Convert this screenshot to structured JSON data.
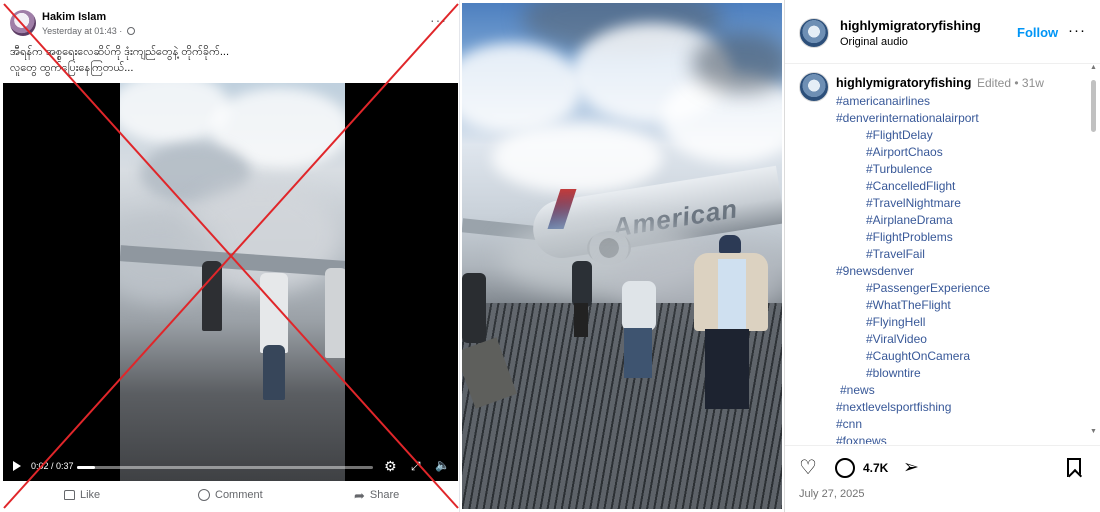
{
  "facebook_post": {
    "author": "Hakim Islam",
    "timestamp": "Yesterday at 01:43 · ",
    "more_label": "···",
    "caption_lines": [
      "အီရန်က အစ္စရေးလေဆိပ်ကို ဒုံးကျည်တွေနဲ့ တိုက်ခိုက်...",
      "လူတွေ ထွက်ပြေးနေကြတယ်..."
    ],
    "video": {
      "time": "0:02 / 0:37",
      "progress": 0.06,
      "settings_icon": "gear-icon",
      "fullscreen_icon": "expand-icon",
      "volume_icon": "volume-mute-icon"
    },
    "actions": {
      "like": "Like",
      "comment": "Comment",
      "share": "Share"
    },
    "overlay": {
      "cross_color": "#e0262a",
      "meaning": "debunked"
    }
  },
  "instagram": {
    "username": "highlymigratoryfishing",
    "audio": "Original audio",
    "follow_label": "Follow",
    "more_label": "···",
    "comment": {
      "username": "highlymigratoryfishing",
      "meta": "Edited • 31w",
      "tags": [
        "#americanairlines",
        "#denverinternationalairport",
        "#FlightDelay",
        "#AirportChaos",
        "#Turbulence",
        "#CancelledFlight",
        "#TravelNightmare",
        "#AirplaneDrama",
        "#FlightProblems",
        "#TravelFail",
        "#9newsdenver",
        "#PassengerExperience",
        "#WhatTheFlight",
        "#FlyingHell",
        "#ViralVideo",
        "#CaughtOnCamera",
        "#blowntire",
        "#news",
        "#nextlevelsportfishing",
        "#cnn",
        "#foxnews"
      ]
    },
    "comment_count": "4.7K",
    "date": "July 27, 2025",
    "photo_text": "American",
    "link_color": "#385898",
    "follow_color": "#0095f6"
  }
}
